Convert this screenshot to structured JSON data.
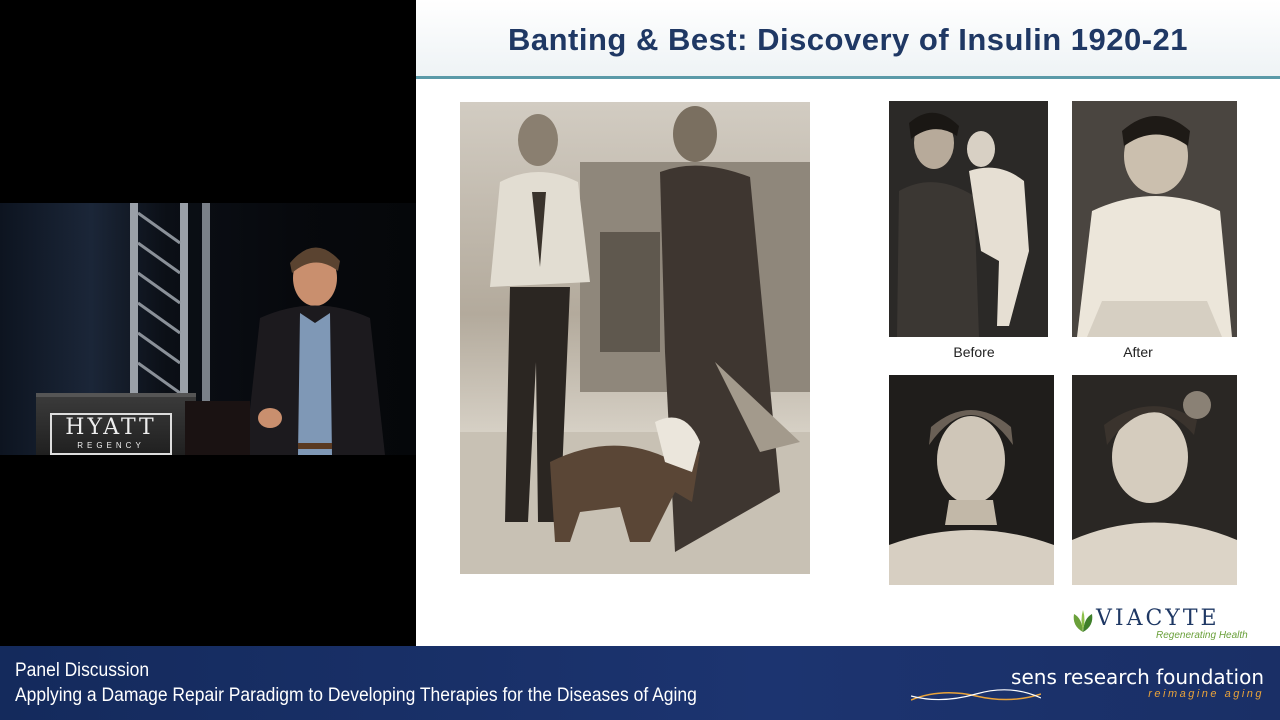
{
  "slide": {
    "title": "Banting & Best:  Discovery of Insulin 1920-21",
    "captions": {
      "before": "Before",
      "after": "After"
    },
    "logo": {
      "name": "VIACYTE",
      "tagline": "Regenerating Health",
      "color": "#1f3864",
      "accent": "#6aa03a"
    }
  },
  "stage": {
    "podium_sign": {
      "main": "HYATT",
      "sub": "REGENCY"
    }
  },
  "lower_third": {
    "title": "Panel Discussion",
    "subtitle": "Applying a Damage Repair Paradigm to Developing Therapies for the Diseases of Aging",
    "org_name": "sens research foundation",
    "org_tagline": "reimagine aging",
    "bg_color": "#1a3068",
    "tagline_color": "#e9a33a"
  },
  "colors": {
    "title_text": "#1f3864",
    "title_rule": "#5a9aa8"
  }
}
